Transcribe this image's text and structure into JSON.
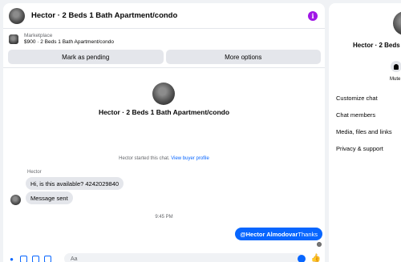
{
  "header": {
    "title": "Hector · 2 Beds 1 Bath Apartment/condo",
    "info_icon": "info-icon",
    "accent": "#a016e6"
  },
  "listing": {
    "label": "Marketplace",
    "details": "$900 · 2 Beds 1 Bath Apartment/condo"
  },
  "actions": {
    "pending": "Mark as pending",
    "more": "More options"
  },
  "profile": {
    "title": "Hector · 2 Beds 1 Bath Apartment/condo"
  },
  "conversation": {
    "started_text": "Hector started this chat.",
    "view_profile": "View buyer profile",
    "sender_name": "Hector",
    "messages_in": [
      "Hi, is this available? 4242029840",
      "Message sent"
    ],
    "time": "9:45 PM",
    "sent_mention": "@Hector Almodovar",
    "sent_text": "Thanks"
  },
  "composer": {
    "placeholder": "Aa",
    "accent": "#0866ff"
  },
  "side": {
    "mute_label": "Mute",
    "items": [
      "Customize chat",
      "Chat members",
      "Media, files and links",
      "Privacy & support"
    ]
  }
}
